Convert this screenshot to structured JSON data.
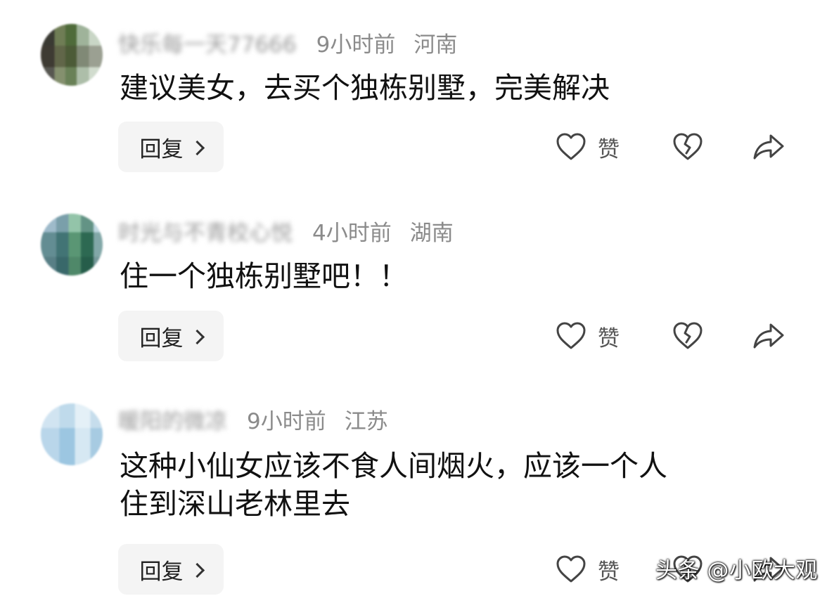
{
  "comments": [
    {
      "username": "快乐每一天77666",
      "time": "9小时前",
      "location": "河南",
      "text_lines": [
        "建议美女，去买个独栋别墅，完美解决"
      ],
      "reply_label": "回复",
      "like_label": "赞"
    },
    {
      "username": "时光与不青校心悦",
      "time": "4小时前",
      "location": "湖南",
      "text_lines": [
        "住一个独栋别墅吧！！"
      ],
      "reply_label": "回复",
      "like_label": "赞"
    },
    {
      "username": "暖阳的微凉",
      "time": "9小时前",
      "location": "江苏",
      "text_lines": [
        "这种小仙女应该不食人间烟火，应该一个人",
        "住到深山老林里去"
      ],
      "reply_label": "回复",
      "like_label": "赞"
    }
  ],
  "icons": {
    "like": "heart-outline-icon",
    "dislike": "broken-heart-icon",
    "share": "share-arrow-icon",
    "reply_chevron": "chevron-right-icon"
  },
  "watermark": "头条 @小欧大观",
  "colors": {
    "meta_text": "#8b8b8b",
    "content_text": "#111111",
    "reply_bg": "#f4f4f4",
    "icon_stroke": "#444444"
  }
}
